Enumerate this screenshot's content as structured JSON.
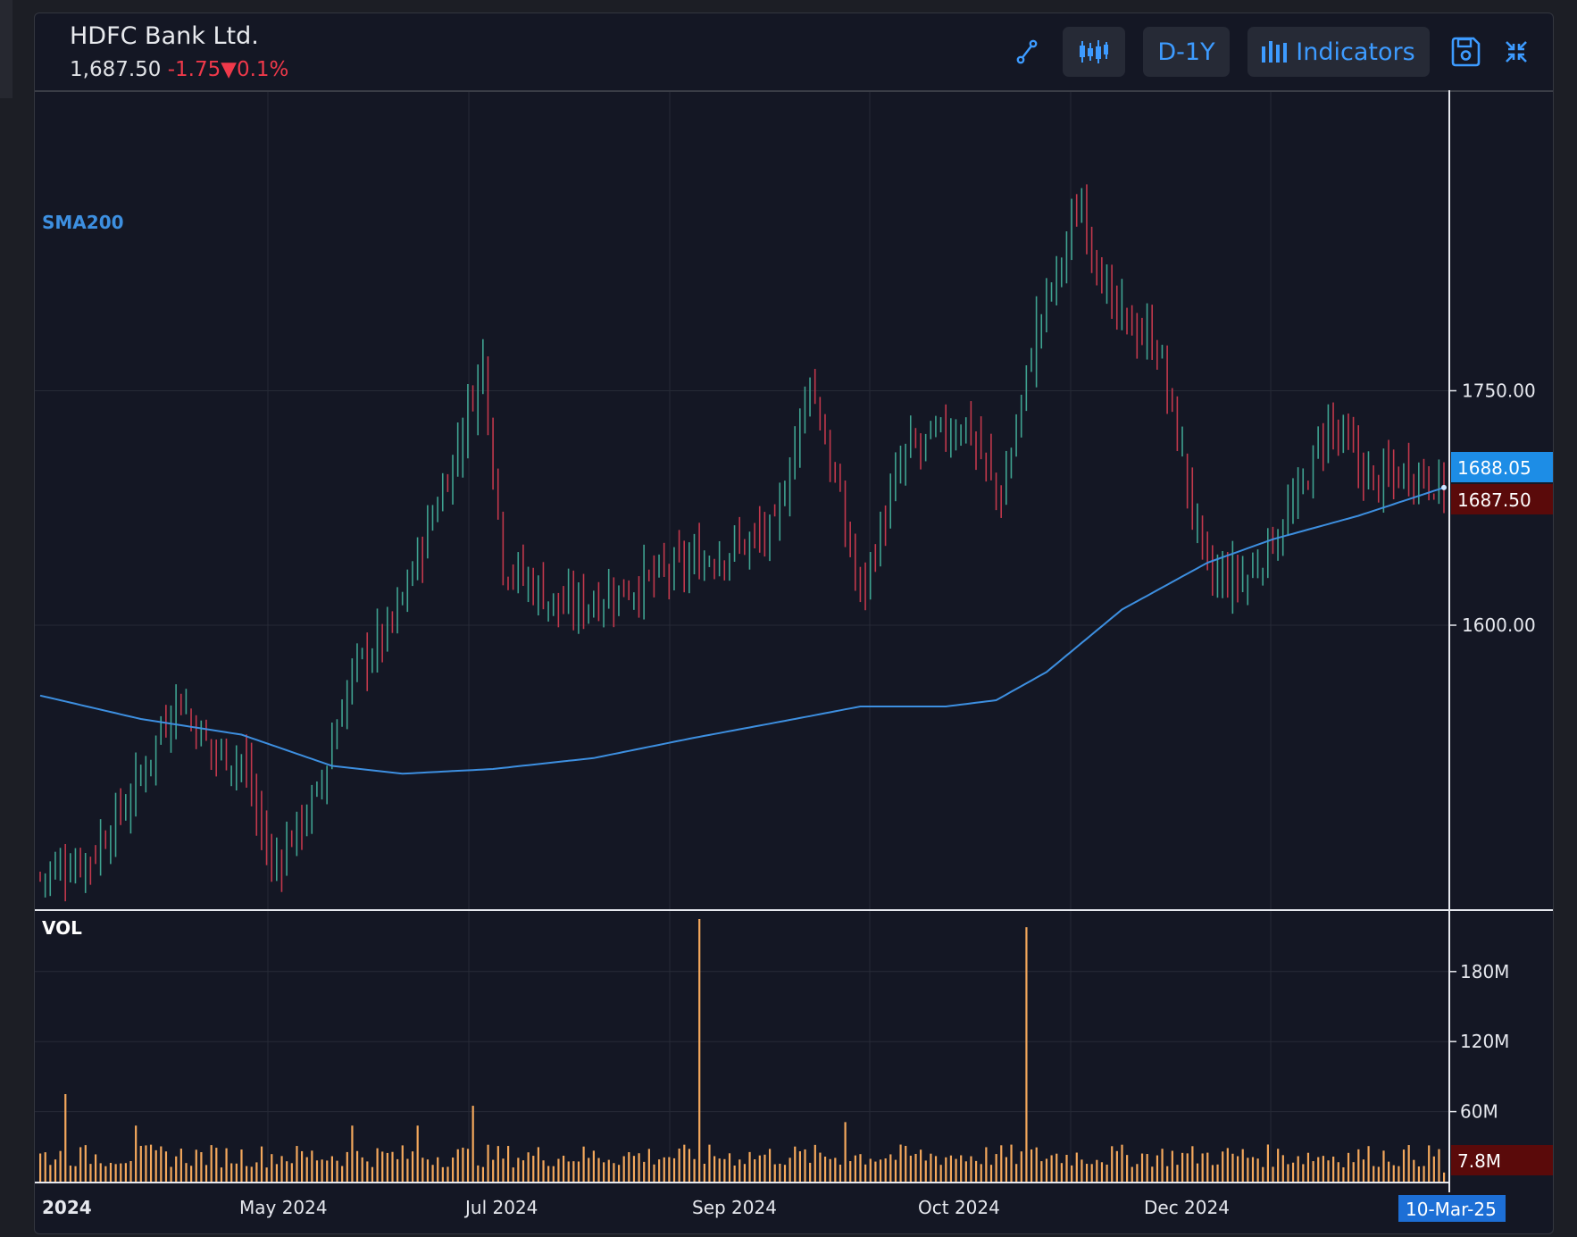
{
  "header": {
    "title": "HDFC Bank Ltd.",
    "price": "1,687.50",
    "change": "-1.75",
    "change_arrow": "▼",
    "change_pct": "0.1%"
  },
  "toolbar": {
    "draw_icon": "trendline-draw-icon",
    "chart_type_icon": "candlestick-chart-icon",
    "period_label": "D-1Y",
    "indicators_label": "Indicators",
    "save_icon": "save-icon",
    "collapse_icon": "collapse-arrows-icon"
  },
  "colors": {
    "background": "#141724",
    "up": "#3fa391",
    "down": "#c2384c",
    "sma": "#3d8fe0",
    "volume": "#f4a85c",
    "accent_blue": "#1d8de6",
    "price_tag_bg": "#5a0a0a"
  },
  "chart_data": [
    {
      "type": "bar",
      "title": "HDFC Bank Ltd.",
      "subtype": "ohlc",
      "y_ticks": [
        "1600.00",
        "1750.00"
      ],
      "ylim": [
        1420,
        1940
      ],
      "x_ticks": [
        "2024",
        "May 2024",
        "Jul 2024",
        "Sep 2024",
        "Oct 2024",
        "Dec 2024",
        "10-Mar-25"
      ],
      "indicator": {
        "name": "SMA200",
        "current": 1688.05,
        "label": "1688.05"
      },
      "last_price": {
        "value": 1687.5,
        "label": "1687.50"
      },
      "cursor_date": "10-Mar-25",
      "price_path": [
        {
          "i": 0,
          "v": 1440
        },
        {
          "i": 10,
          "v": 1452
        },
        {
          "i": 18,
          "v": 1490
        },
        {
          "i": 27,
          "v": 1555
        },
        {
          "i": 34,
          "v": 1520
        },
        {
          "i": 40,
          "v": 1515
        },
        {
          "i": 46,
          "v": 1445
        },
        {
          "i": 55,
          "v": 1490
        },
        {
          "i": 62,
          "v": 1570
        },
        {
          "i": 70,
          "v": 1600
        },
        {
          "i": 82,
          "v": 1705
        },
        {
          "i": 88,
          "v": 1770
        },
        {
          "i": 92,
          "v": 1640
        },
        {
          "i": 104,
          "v": 1610
        },
        {
          "i": 118,
          "v": 1625
        },
        {
          "i": 130,
          "v": 1640
        },
        {
          "i": 146,
          "v": 1660
        },
        {
          "i": 153,
          "v": 1760
        },
        {
          "i": 163,
          "v": 1620
        },
        {
          "i": 172,
          "v": 1710
        },
        {
          "i": 184,
          "v": 1730
        },
        {
          "i": 191,
          "v": 1680
        },
        {
          "i": 198,
          "v": 1790
        },
        {
          "i": 207,
          "v": 1870
        },
        {
          "i": 213,
          "v": 1800
        },
        {
          "i": 222,
          "v": 1780
        },
        {
          "i": 232,
          "v": 1630
        },
        {
          "i": 240,
          "v": 1630
        },
        {
          "i": 250,
          "v": 1680
        },
        {
          "i": 256,
          "v": 1730
        },
        {
          "i": 265,
          "v": 1690
        },
        {
          "i": 273,
          "v": 1700
        },
        {
          "i": 279,
          "v": 1687.5
        }
      ],
      "sma200_path": [
        {
          "i": 0,
          "v": 1555
        },
        {
          "i": 20,
          "v": 1540
        },
        {
          "i": 40,
          "v": 1530
        },
        {
          "i": 58,
          "v": 1510
        },
        {
          "i": 72,
          "v": 1505
        },
        {
          "i": 90,
          "v": 1508
        },
        {
          "i": 110,
          "v": 1515
        },
        {
          "i": 130,
          "v": 1528
        },
        {
          "i": 150,
          "v": 1540
        },
        {
          "i": 163,
          "v": 1548
        },
        {
          "i": 180,
          "v": 1548
        },
        {
          "i": 190,
          "v": 1552
        },
        {
          "i": 200,
          "v": 1570
        },
        {
          "i": 215,
          "v": 1610
        },
        {
          "i": 232,
          "v": 1640
        },
        {
          "i": 245,
          "v": 1655
        },
        {
          "i": 262,
          "v": 1670
        },
        {
          "i": 279,
          "v": 1688.05
        }
      ]
    },
    {
      "type": "bar",
      "title": "VOL",
      "y_ticks": [
        "60M",
        "120M",
        "180M"
      ],
      "ylim": [
        0,
        225
      ],
      "current": "7.8M",
      "typical_volume_m": 22,
      "spikes": [
        {
          "i": 5,
          "v": 75
        },
        {
          "i": 19,
          "v": 48
        },
        {
          "i": 62,
          "v": 48
        },
        {
          "i": 75,
          "v": 48
        },
        {
          "i": 86,
          "v": 65
        },
        {
          "i": 131,
          "v": 225
        },
        {
          "i": 160,
          "v": 51
        },
        {
          "i": 196,
          "v": 218
        }
      ]
    }
  ]
}
